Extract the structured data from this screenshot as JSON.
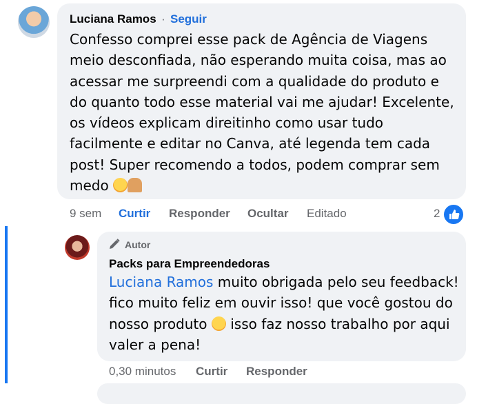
{
  "comment": {
    "author": "Luciana Ramos",
    "separator": "·",
    "follow_label": "Seguir",
    "text": "Confesso comprei esse pack de Agência de Viagens meio desconfiada, não esperando muita coisa, mas ao acessar me surpreendi com a qualidade do produto e do quanto todo esse material vai me ajudar! Excelente, os vídeos explicam direitinho como usar tudo facilmente e editar no Canva, até legenda tem cada post! Super recomendo a todos, podem comprar sem medo",
    "emojis": [
      "hugging-face-icon",
      "praying-hands-icon"
    ],
    "time": "9 sem",
    "like_label": "Curtir",
    "reply_label": "Responder",
    "hide_label": "Ocultar",
    "edited_label": "Editado",
    "like_count": "2",
    "accent_color": "#216fdb"
  },
  "reply": {
    "badge_label": "Autor",
    "author": "Packs para Empreendedoras",
    "mention": "Luciana Ramos",
    "text_before_emoji": " muito obrigada pelo seu feedback! fico muito feliz em ouvir isso! que você gostou do nosso produto",
    "text_after_emoji": " isso faz nosso trabalho por aqui valer a pena!",
    "emoji": "smiling-face-icon",
    "time": "0,30 minutos",
    "like_label": "Curtir",
    "reply_label": "Responder"
  }
}
